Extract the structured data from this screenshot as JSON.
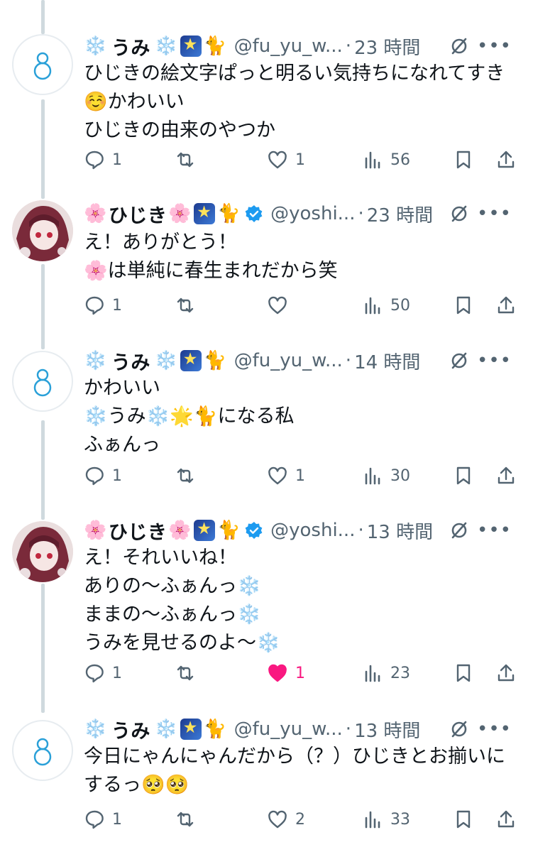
{
  "tweets": [
    {
      "avatar": "snowman-avatar",
      "name_emoji_left": "❄️",
      "name": "うみ",
      "name_emoji_right": "❄️",
      "name_suffix_emoji": "🐈",
      "verified": false,
      "handle": "@fu_yu_w...",
      "dot": "·",
      "time": "23 時間",
      "body": [
        "ひじきの絵文字ぱっと明るい気持ちになれてすき",
        "☺️かわいい",
        "ひじきの由来のやつか"
      ],
      "reply_count": "1",
      "retweet_count": "",
      "like_count": "1",
      "view_count": "56",
      "liked": false
    },
    {
      "avatar": "anime-girl-avatar",
      "name_emoji_left": "🌸",
      "name": "ひじき",
      "name_emoji_right": "🌸",
      "name_suffix_emoji": "🐈",
      "verified": true,
      "handle": "@yoshi...",
      "dot": "·",
      "time": "23 時間",
      "body": [
        "え！ありがとう！",
        "🌸は単純に春生まれだから笑"
      ],
      "reply_count": "1",
      "retweet_count": "",
      "like_count": "",
      "view_count": "50",
      "liked": false
    },
    {
      "avatar": "snowman-avatar",
      "name_emoji_left": "❄️",
      "name": "うみ",
      "name_emoji_right": "❄️",
      "name_suffix_emoji": "🐈",
      "verified": false,
      "handle": "@fu_yu_w...",
      "dot": "·",
      "time": "14 時間",
      "body": [
        "かわいい",
        "❄️うみ❄️🌟🐈になる私",
        "ふぁんっ"
      ],
      "reply_count": "1",
      "retweet_count": "",
      "like_count": "1",
      "view_count": "30",
      "liked": false
    },
    {
      "avatar": "anime-girl-avatar",
      "name_emoji_left": "🌸",
      "name": "ひじき",
      "name_emoji_right": "🌸",
      "name_suffix_emoji": "🐈",
      "verified": true,
      "handle": "@yoshi...",
      "dot": "·",
      "time": "13 時間",
      "body": [
        "え！それいいね！",
        "ありの〜ふぁんっ❄️",
        "ままの〜ふぁんっ❄️",
        "うみを見せるのよ〜❄️"
      ],
      "reply_count": "1",
      "retweet_count": "",
      "like_count": "1",
      "view_count": "23",
      "liked": true
    },
    {
      "avatar": "snowman-avatar",
      "name_emoji_left": "❄️",
      "name": "うみ",
      "name_emoji_right": "❄️",
      "name_suffix_emoji": "🐈",
      "verified": false,
      "handle": "@fu_yu_w...",
      "dot": "·",
      "time": "13 時間",
      "body": [
        "今日にゃんにゃんだから（？）ひじきとお揃いに",
        "するっ🥺🥺"
      ],
      "reply_count": "1",
      "retweet_count": "",
      "like_count": "2",
      "view_count": "33",
      "liked": false
    }
  ],
  "colors": {
    "text": "#0f1419",
    "secondary": "#536471",
    "thread_line": "#cfd9de",
    "like_active": "#f91880",
    "verified": "#1d9bf0"
  },
  "icons": [
    "reply-icon",
    "retweet-icon",
    "like-icon",
    "views-icon",
    "bookmark-icon",
    "share-icon",
    "grok-icon",
    "more-icon",
    "verified-badge-icon"
  ]
}
